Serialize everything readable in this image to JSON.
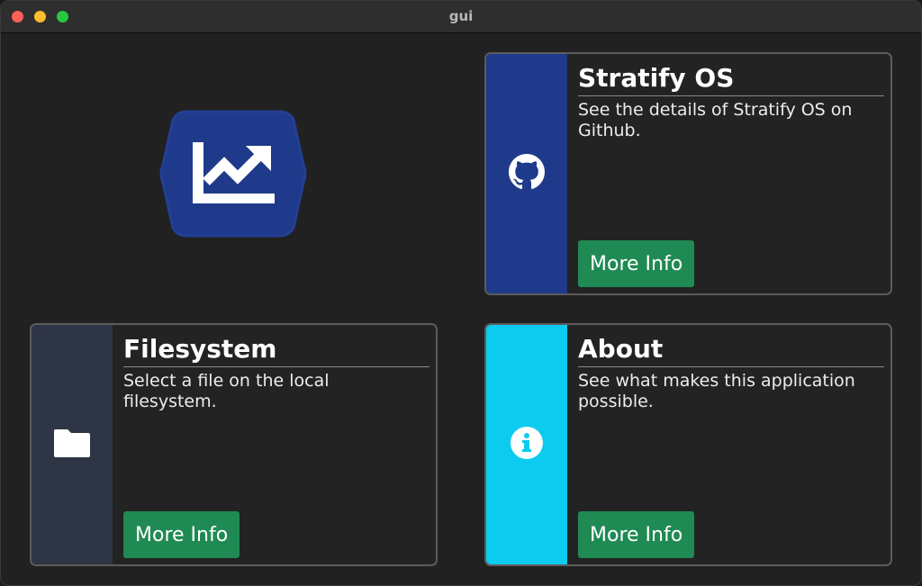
{
  "window": {
    "title": "gui"
  },
  "logo": {
    "icon": "trending-up-chart-icon",
    "color": "#1f3a8a"
  },
  "cards": [
    {
      "title": "Stratify OS",
      "description": "See the details of Stratify OS on Github.",
      "button_label": "More Info",
      "icon": "github-icon",
      "accent": "#1f3a8a"
    },
    {
      "title": "Filesystem",
      "description": "Select a file on the local filesystem.",
      "button_label": "More Info",
      "icon": "folder-icon",
      "accent": "#2e3545"
    },
    {
      "title": "About",
      "description": "See what makes this application possible.",
      "button_label": "More Info",
      "icon": "info-icon",
      "accent": "#0ccbef"
    }
  ],
  "colors": {
    "background": "#212121",
    "button": "#1f8a53",
    "card_border": "#5c5c5c"
  }
}
